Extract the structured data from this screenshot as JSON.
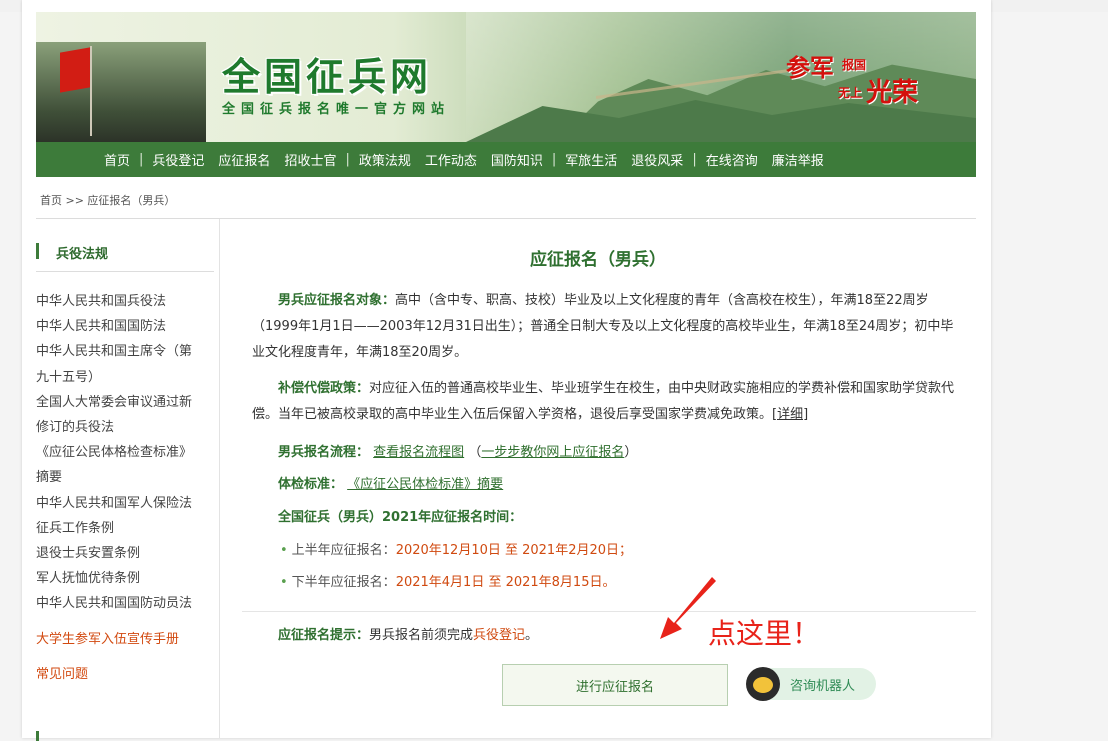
{
  "banner": {
    "logo": "全国征兵网",
    "slogan": "全国征兵报名唯一官方网站",
    "motto_1": "参军",
    "motto_2": "报国",
    "motto_3": "无上",
    "motto_4": "光荣"
  },
  "nav": {
    "items": [
      "首页",
      "兵役登记",
      "应征报名",
      "招收士官",
      "政策法规",
      "工作动态",
      "国防知识",
      "军旅生活",
      "退役风采",
      "在线咨询",
      "廉洁举报"
    ],
    "separator": "|"
  },
  "breadcrumb": "首页 >> 应征报名（男兵）",
  "sidebar": {
    "title": "兵役法规",
    "items": [
      "中华人民共和国兵役法",
      "中华人民共和国国防法",
      "中华人民共和国主席令（第",
      "九十五号）",
      "全国人大常委会审议通过新",
      "修订的兵役法",
      "《应征公民体格检查标准》",
      "摘要",
      "中华人民共和国军人保险法",
      "征兵工作条例",
      "退役士兵安置条例",
      "军人抚恤优待条例",
      "中华人民共和国国防动员法"
    ],
    "red_items": [
      "大学生参军入伍宣传手册",
      "常见问题"
    ]
  },
  "main": {
    "title": "应征报名（男兵）",
    "p1_label": "男兵应征报名对象：",
    "p1_text": "高中（含中专、职高、技校）毕业及以上文化程度的青年（含高校在校生），年满18至22周岁（1999年1月1日——2003年12月31日出生）；普通全日制大专及以上文化程度的高校毕业生，年满18至24周岁；初中毕业文化程度青年，年满18至20周岁。",
    "p2_label": "补偿代偿政策：",
    "p2_text": "对应征入伍的普通高校毕业生、毕业班学生在校生，由中央财政实施相应的学费补偿和国家助学贷款代偿。当年已被高校录取的高中毕业生入伍后保留入学资格，退役后享受国家学费减免政策。",
    "p2_link": "[详细]",
    "flow_label": "男兵报名流程：",
    "flow_link1": "查看报名流程图",
    "flow_open": "（",
    "flow_link2": "一步步教你网上应征报名",
    "flow_close": "）",
    "std_label": "体检标准：",
    "std_link": "《应征公民体检标准》摘要",
    "time_label": "全国征兵（男兵）2021年应征报名时间：",
    "first_half_label": "上半年应征报名：",
    "first_half_date": "2020年12月10日 至 2021年2月20日；",
    "second_half_label": "下半年应征报名：",
    "second_half_date": "2021年4月1日 至 2021年8月15日。",
    "tip_label": "应征报名提示：",
    "tip_text": "男兵报名前须完成",
    "tip_link": "兵役登记",
    "tip_end": "。",
    "button": "进行应征报名",
    "robot": "咨询机器人",
    "annotation": "点这里！"
  }
}
